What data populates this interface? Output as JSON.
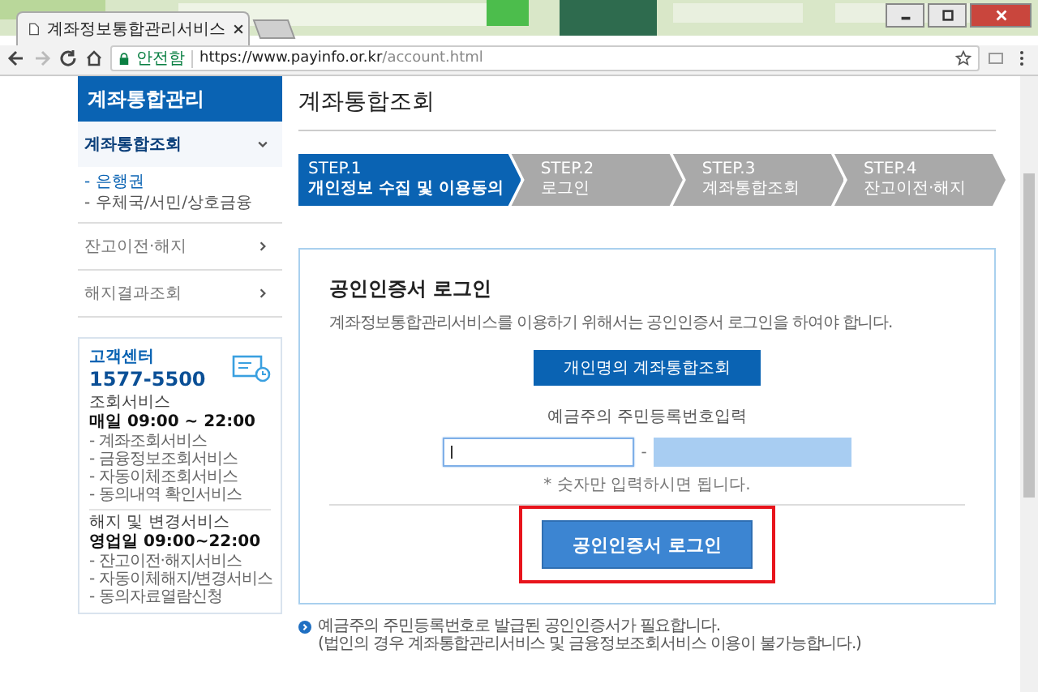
{
  "browser": {
    "tab_title": "계좌정보통합관리서비스",
    "security_label": "안전함",
    "url_host": "https://www.payinfo.or.kr",
    "url_path": "/account.html"
  },
  "sidebar": {
    "title": "계좌통합관리",
    "menu": [
      {
        "label": "계좌통합조회",
        "expanded": true,
        "children": [
          {
            "label": "- 은행권",
            "selected": true
          },
          {
            "label": "- 우체국/서민/상호금융",
            "selected": false
          }
        ]
      },
      {
        "label": "잔고이전·해지",
        "expanded": false
      },
      {
        "label": "해지결과조회",
        "expanded": false
      }
    ],
    "support": {
      "title": "고객센터",
      "phone": "1577-5500",
      "groups": [
        {
          "name": "조회서비스",
          "hours": "매일 09:00 ~ 22:00",
          "items": [
            "- 계좌조회서비스",
            "- 금융정보조회서비스",
            "- 자동이체조회서비스",
            "- 동의내역 확인서비스"
          ]
        },
        {
          "name": "해지 및 변경서비스",
          "hours": "영업일 09:00~22:00",
          "items": [
            "- 잔고이전·해지서비스",
            "- 자동이체해지/변경서비스",
            "- 동의자료열람신청"
          ]
        }
      ]
    }
  },
  "page_title": "계좌통합조회",
  "steps": [
    {
      "number": "STEP.1",
      "label": "개인정보 수집 및 이용동의",
      "selected": true
    },
    {
      "number": "STEP.2",
      "label": "로그인",
      "selected": false
    },
    {
      "number": "STEP.3",
      "label": "계좌통합조회",
      "selected": false
    },
    {
      "number": "STEP.4",
      "label": "잔고이전·해지",
      "selected": false
    }
  ],
  "login": {
    "heading": "공인인증서 로그인",
    "description": "계좌정보통합관리서비스를 이용하기 위해서는 공인인증서 로그인을 하여야 합니다.",
    "personal_button": "개인명의 계좌통합조회",
    "rrn_label": "예금주의 주민등록번호입력",
    "rrn_fields": [
      {
        "kind": "plain",
        "focused": true
      },
      {
        "kind": "secure",
        "focused": false
      }
    ],
    "separator": "-",
    "hint": "* 숫자만 입력하시면 됩니다.",
    "login_button": "공인인증서 로그인",
    "login_highlighted": true
  },
  "notes": [
    "예금주의 주민등록번호로 발급된 공인인증서가 필요합니다.",
    "(법인의 경우 계좌통합관리서비스 및 금융정보조회서비스 이용이 불가능합니다.)"
  ]
}
